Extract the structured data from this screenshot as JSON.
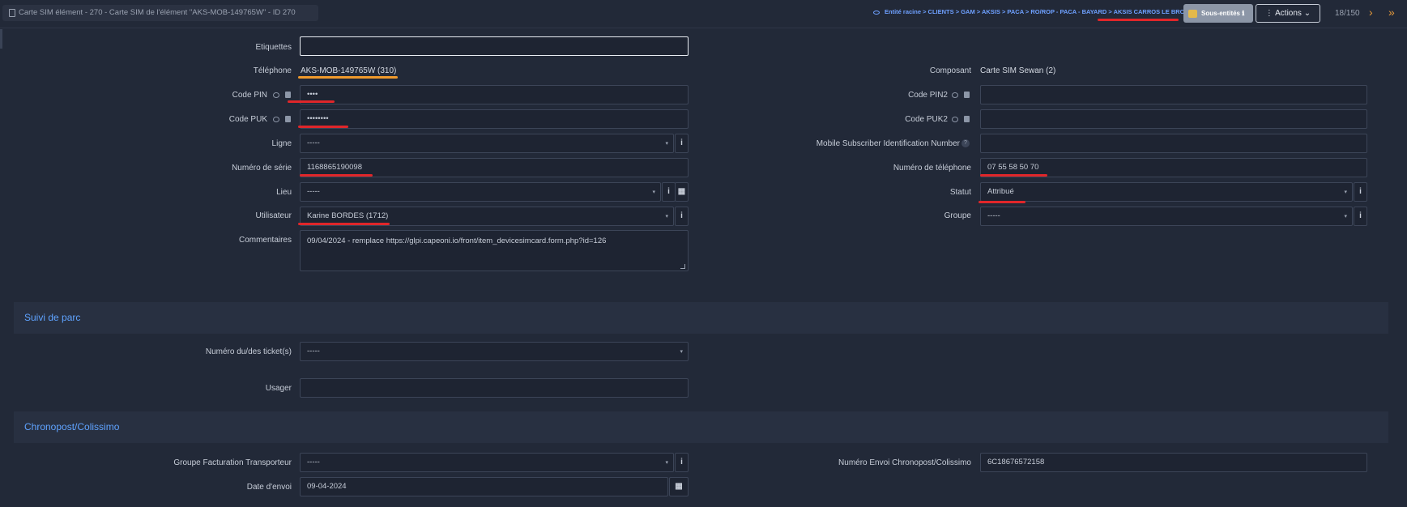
{
  "header": {
    "title": "Carte SIM élément - 270 - Carte SIM de l'élément \"AKS-MOB-149765W\" - ID 270",
    "breadcrumb": "Entité racine > CLIENTS > GAM > AKSIS > PACA > RO/ROP - PACA - BAYARD > AKSIS CARROS LE BROC",
    "subentities_label": "Sous-entités",
    "actions_label": "Actions",
    "pager": "18/150"
  },
  "form": {
    "etiquettes_label": "Etiquettes",
    "etiquettes_value": "",
    "telephone_label": "Téléphone",
    "telephone_value": "AKS-MOB-149765W (310)",
    "composant_label": "Composant",
    "composant_value": "Carte SIM Sewan (2)",
    "pin_label": "Code PIN",
    "pin_value": "••••",
    "pin2_label": "Code PIN2",
    "pin2_value": "",
    "puk_label": "Code PUK",
    "puk_value": "••••••••",
    "puk2_label": "Code PUK2",
    "puk2_value": "",
    "ligne_label": "Ligne",
    "ligne_value": "-----",
    "msin_label": "Mobile Subscriber Identification Number",
    "msin_value": "",
    "serial_label": "Numéro de série",
    "serial_value": "1168865190098",
    "phone_number_label": "Numéro de téléphone",
    "phone_number_value": "07 55 58 50 70",
    "lieu_label": "Lieu",
    "lieu_value": "-----",
    "statut_label": "Statut",
    "statut_value": "Attribué",
    "utilisateur_label": "Utilisateur",
    "utilisateur_value": "Karine BORDES (1712)",
    "groupe_label": "Groupe",
    "groupe_value": "-----",
    "commentaires_label": "Commentaires",
    "commentaires_value": "09/04/2024 - remplace https://glpi.capeoni.io/front/item_devicesimcard.form.php?id=126"
  },
  "suivi": {
    "section_title": "Suivi de parc",
    "tickets_label": "Numéro du/des ticket(s)",
    "tickets_value": "-----",
    "usager_label": "Usager",
    "usager_value": ""
  },
  "chrono": {
    "section_title": "Chronopost/Colissimo",
    "groupe_fact_label": "Groupe Facturation Transporteur",
    "groupe_fact_value": "-----",
    "envoi_label": "Numéro Envoi Chronopost/Colissimo",
    "envoi_value": "6C18676572158",
    "date_label": "Date d'envoi",
    "date_value": "09-04-2024"
  },
  "colors": {
    "background": "#222938",
    "accent": "#5fa3ff",
    "highlight_red": "#e0262a",
    "highlight_orange": "#f09a2c"
  }
}
